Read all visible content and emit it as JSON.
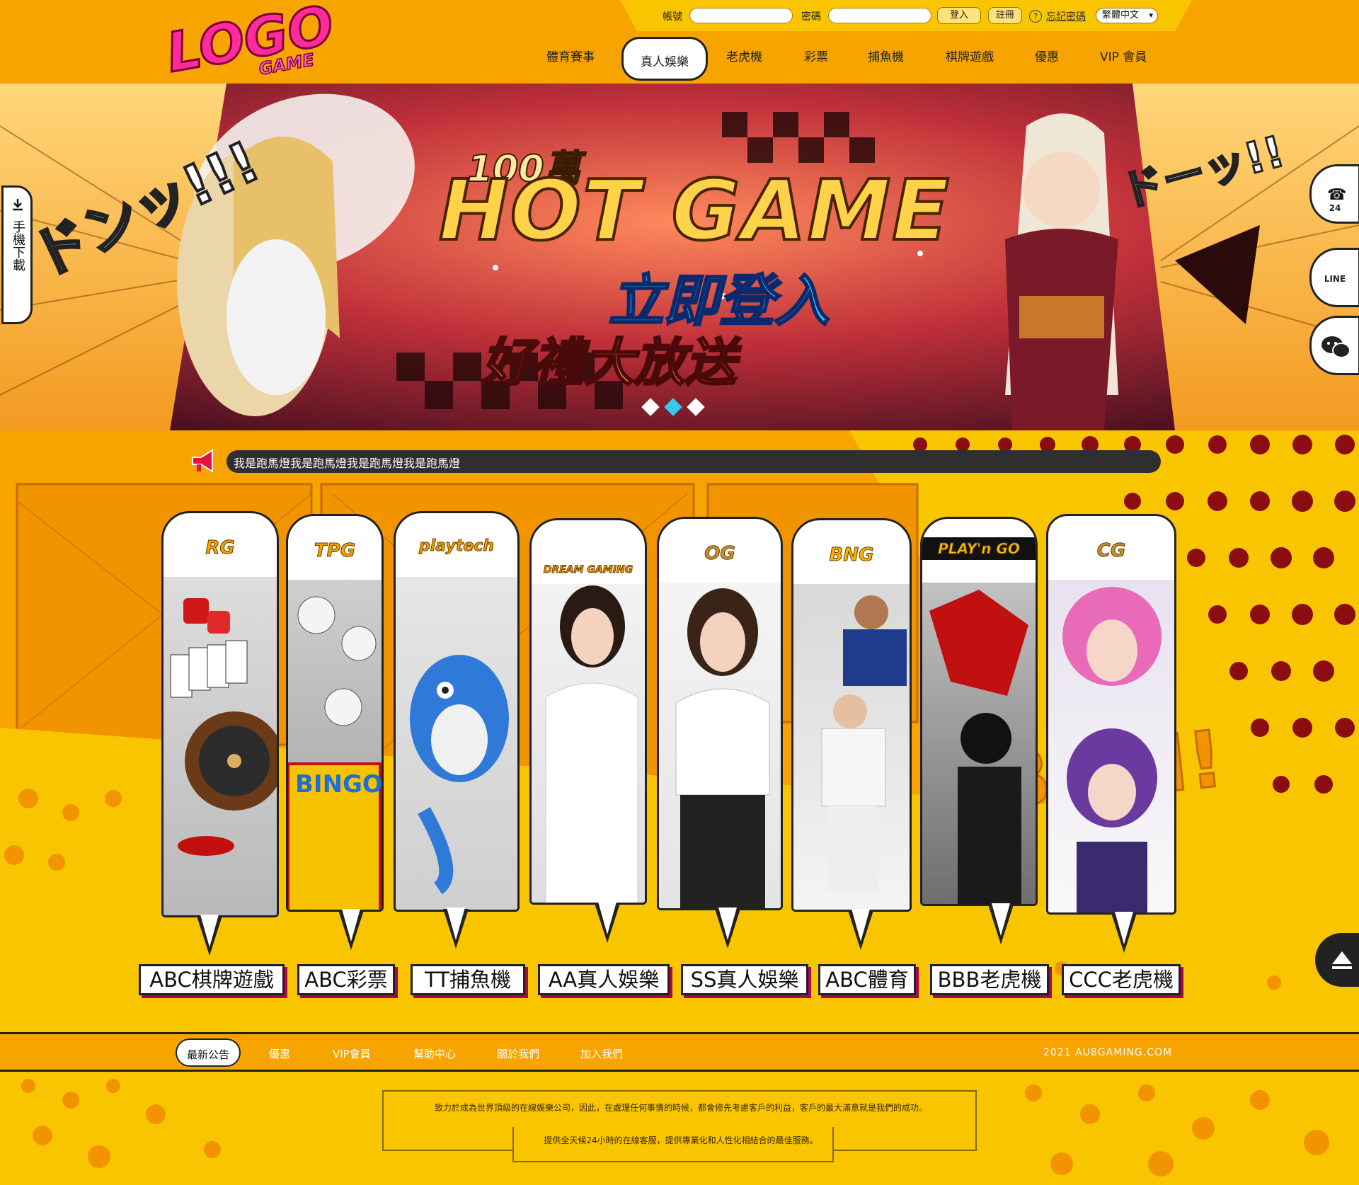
{
  "header": {
    "logo_text": "LOGO",
    "logo_sub": "GAME",
    "account_label": "帳號",
    "account_value": "",
    "password_label": "密碼",
    "password_value": "",
    "login_button": "登入",
    "register_button": "註冊",
    "forgot_password": "忘記密碼",
    "language_selected": "繁體中文",
    "nav": [
      {
        "label": "體育賽事"
      },
      {
        "label": "真人娛樂",
        "active": true
      },
      {
        "label": "老虎機"
      },
      {
        "label": "彩票"
      },
      {
        "label": "捕魚機"
      },
      {
        "label": "棋牌遊戲"
      },
      {
        "label": "優惠"
      },
      {
        "label": "VIP 會員"
      }
    ]
  },
  "banner": {
    "million": "100萬",
    "headline": "HOT GAME",
    "subheadline": "立即登入",
    "tagline": "好禮大放送",
    "slides": 3,
    "active_slide": 2
  },
  "sidebar_left": {
    "mobile_download": "手機下載"
  },
  "sidebar_right": {
    "support_24": "24",
    "line": "LINE",
    "wechat_icon": "wechat-icon"
  },
  "marquee": {
    "text": "我是跑馬燈我是跑馬燈我是跑馬燈我是跑馬燈"
  },
  "providers": [
    {
      "logo": "RG",
      "label": "ABC棋牌遊戲"
    },
    {
      "logo": "TPG",
      "label": "ABC彩票"
    },
    {
      "logo": "playtech",
      "label": "TT捕魚機"
    },
    {
      "logo": "DREAM GAMING",
      "label": "AA真人娛樂"
    },
    {
      "logo": "OG",
      "label": "SS真人娛樂"
    },
    {
      "logo": "BNG",
      "label": "ABC體育"
    },
    {
      "logo": "PLAY'n GO",
      "label": "BBB老虎機"
    },
    {
      "logo": "CG",
      "label": "CCC老虎機"
    }
  ],
  "footer_nav": [
    {
      "label": "最新公告",
      "active": true
    },
    {
      "label": "優惠"
    },
    {
      "label": "VIP會員"
    },
    {
      "label": "幫助中心"
    },
    {
      "label": "關於我們"
    },
    {
      "label": "加入我們"
    }
  ],
  "copyright": "2021 AU8GAMING.COM",
  "footer": {
    "line1": "致力於成為世界頂級的在線娛樂公司，因此，在處理任何事情的時候，都會修先考慮客戶的利益，客戶的最大滿意就是我們的成功。",
    "line2": "提供全天候24小時的在線客服，提供專業化和人性化相結合的最佳服務。"
  },
  "colors": {
    "orange": "#f7a400",
    "yellow": "#f9c400",
    "pink": "#ff1a8c",
    "dark": "#222222",
    "accent_blue": "#37c9e8"
  }
}
